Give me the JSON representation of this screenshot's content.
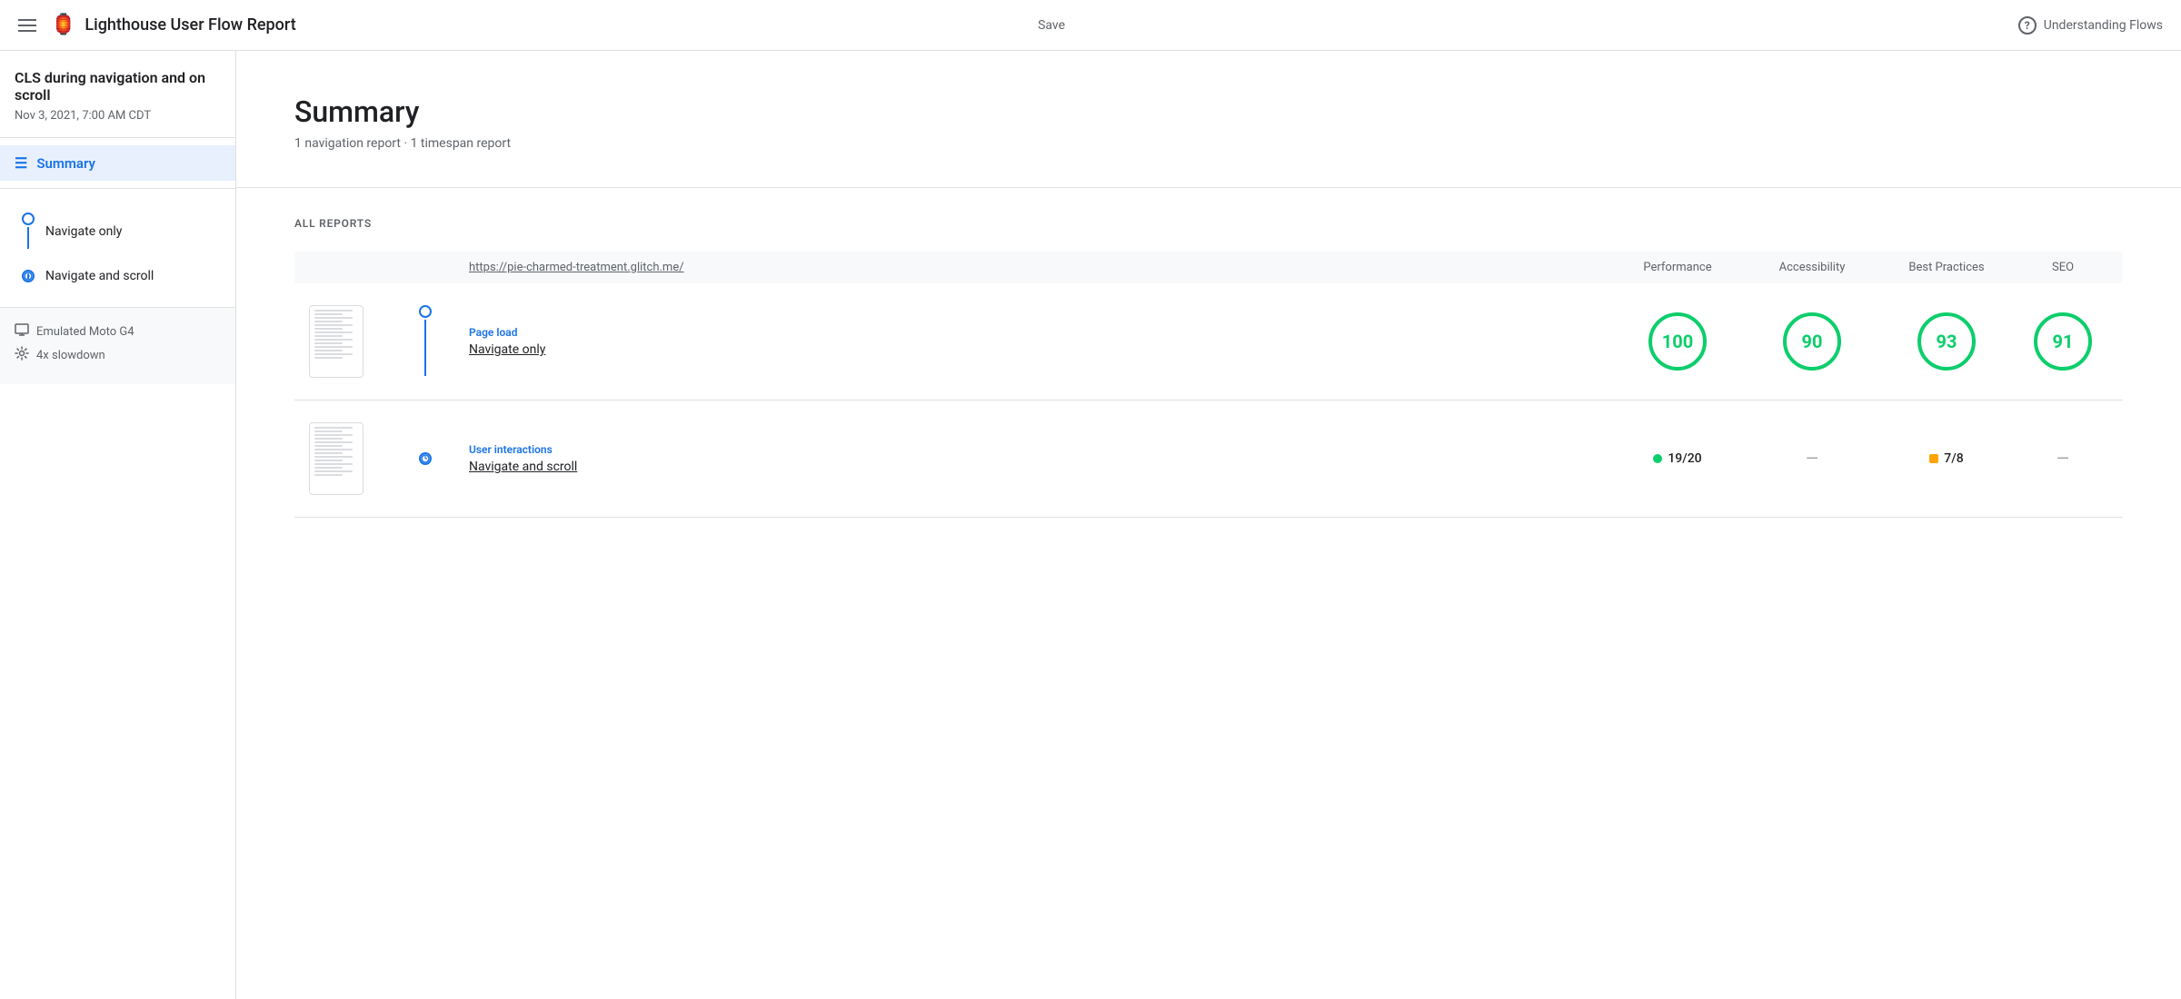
{
  "header": {
    "title": "Lighthouse User Flow Report",
    "save_label": "Save",
    "understanding_label": "Understanding Flows",
    "logo_char": "🏮"
  },
  "sidebar": {
    "project_title": "CLS during navigation and on scroll",
    "project_date": "Nov 3, 2021, 7:00 AM CDT",
    "summary_label": "Summary",
    "flows": [
      {
        "label": "Navigate only",
        "type": "circle"
      },
      {
        "label": "Navigate and scroll",
        "type": "clock"
      }
    ],
    "device_items": [
      {
        "icon": "🖥",
        "label": "Emulated Moto G4"
      },
      {
        "icon": "⚙",
        "label": "4x slowdown"
      }
    ]
  },
  "main": {
    "summary_title": "Summary",
    "summary_subtitle": "1 navigation report · 1 timespan report",
    "all_reports_label": "ALL REPORTS",
    "table_header": {
      "url": "https://pie-charmed-treatment.glitch.me/",
      "cols": [
        "Performance",
        "Accessibility",
        "Best Practices",
        "SEO"
      ]
    },
    "reports": [
      {
        "type": "Page load",
        "name": "Navigate only",
        "flow_type": "circle",
        "scores": {
          "performance": {
            "value": "100",
            "type": "circle",
            "color": "green"
          },
          "accessibility": {
            "value": "90",
            "type": "circle",
            "color": "green"
          },
          "best_practices": {
            "value": "93",
            "type": "circle",
            "color": "green"
          },
          "seo": {
            "value": "91",
            "type": "circle",
            "color": "green"
          }
        }
      },
      {
        "type": "User interactions",
        "name": "Navigate and scroll",
        "flow_type": "clock",
        "scores": {
          "performance": {
            "value": "19/20",
            "type": "pill",
            "color": "green"
          },
          "accessibility": {
            "value": "—",
            "type": "dash"
          },
          "best_practices": {
            "value": "7/8",
            "type": "pill",
            "color": "orange"
          },
          "seo": {
            "value": "—",
            "type": "dash"
          }
        }
      }
    ]
  }
}
